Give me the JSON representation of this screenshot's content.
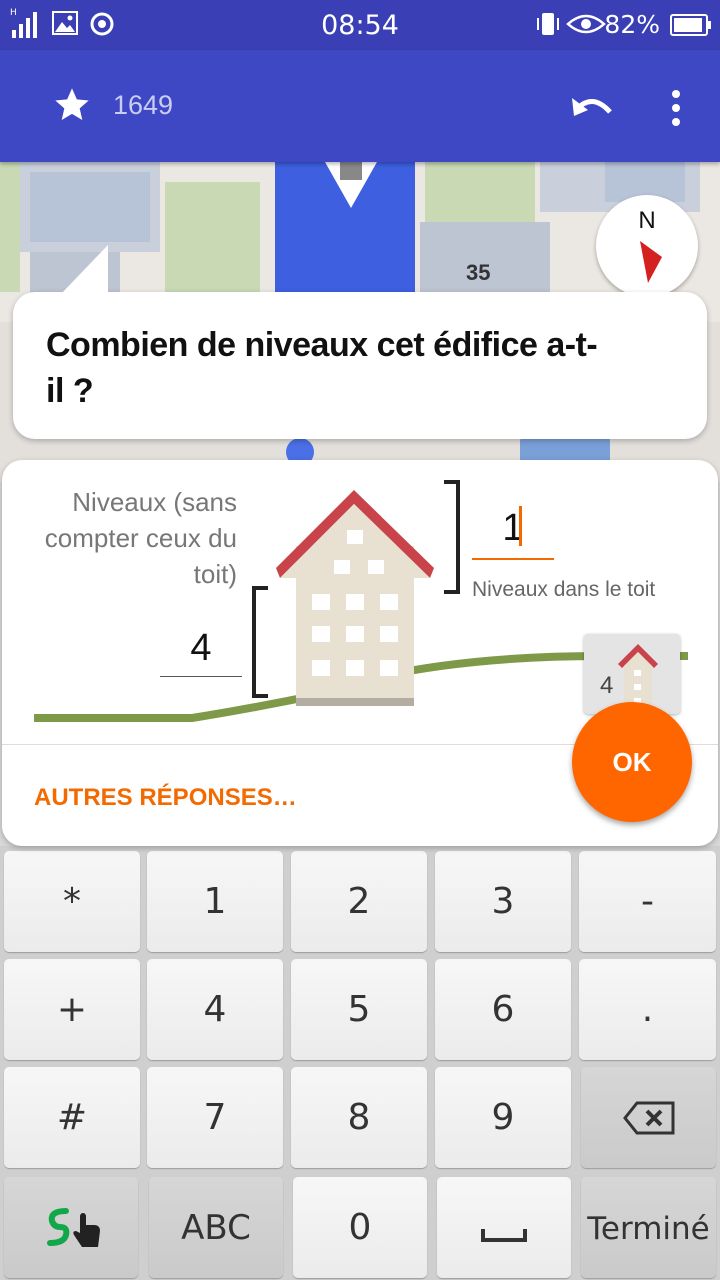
{
  "status_bar": {
    "time": "08:54",
    "battery": "82%"
  },
  "toolbar": {
    "star_count": "1649"
  },
  "map": {
    "house_number": "35",
    "compass_letter": "N"
  },
  "question": {
    "text": "Combien de niveaux cet édifice a-t-il ?"
  },
  "form": {
    "floors_label": "Niveaux (sans compter ceux du toit)",
    "floors_value": "4",
    "roof_value": "1",
    "roof_label": "Niveaux dans le toit",
    "small_icon_number": "4",
    "other_answers": "AUTRES RÉPONSES…",
    "ok": "OK"
  },
  "keyboard": {
    "rows": [
      [
        "*",
        "1",
        "2",
        "3",
        "-"
      ],
      [
        "+",
        "4",
        "5",
        "6",
        "."
      ],
      [
        "#",
        "7",
        "8",
        "9",
        "backspace"
      ],
      [
        "swype",
        "ABC",
        "0",
        "space",
        "Terminé"
      ]
    ]
  },
  "colors": {
    "primary": "#3f48c4",
    "accent": "#ff6600",
    "roof": "#c9434b",
    "ground": "#7e9a48"
  }
}
